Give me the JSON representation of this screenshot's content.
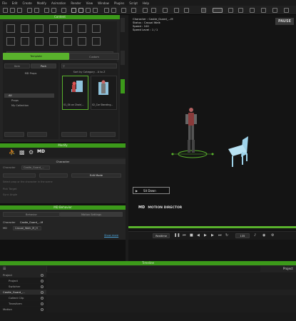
{
  "menubar": [
    "File",
    "Edit",
    "Create",
    "Modify",
    "Animation",
    "Render",
    "View",
    "Window",
    "Plugins",
    "Script",
    "Help"
  ],
  "content_panel": {
    "title": "Content",
    "tabs": [
      "Template",
      "Custom"
    ],
    "side_tabs": [
      "Scene",
      "Visual",
      "Content"
    ],
    "library_tabs": [
      "Item",
      "Pack"
    ],
    "group_label": "MD Props",
    "tree": [
      {
        "label": "All",
        "selected": true
      },
      {
        "label": "Props",
        "selected": false
      },
      {
        "label": "My Collection",
        "selected": false
      }
    ],
    "sort_label": "Sort by Category - A to Z",
    "items": [
      {
        "label": "01_Sit on Chair(...",
        "selected": true
      },
      {
        "label": "02_Car Standing...",
        "selected": false
      }
    ]
  },
  "modify_panel": {
    "title": "Modify",
    "section": "Character",
    "type_label": "Character",
    "character_name": "Castle_Guard_...",
    "mode_label": "Edit Mode",
    "hint": "Select prop or the character in the scene",
    "check1": "Pick Target",
    "check2": "Sync Angle"
  },
  "md_behavior": {
    "title": "MD Behavior",
    "tabs": [
      "Behavior",
      "Motion Settings"
    ],
    "character_label": "Character",
    "character_value": "Castle_Guard_...M",
    "md_label": "MD",
    "md_value": "Casual_Walk_M_H",
    "show_more": "Show more"
  },
  "viewport": {
    "info": [
      "Character : Castle_Guard_...M",
      "Status : Casual Walk",
      "Speed : 100",
      "Speed Level : 1 / 1"
    ],
    "pause_label": "PAUSE",
    "prompt_button": "Sit Down",
    "brand": "MOTION DIRECTOR",
    "playback_label": "Realtime",
    "frame_value": "135"
  },
  "timeline": {
    "title": "Timeline",
    "project_label": "Project",
    "rows": [
      {
        "name": "Project",
        "indent": 0
      },
      {
        "name": "Project",
        "indent": 1
      },
      {
        "name": "Switcher",
        "indent": 1
      },
      {
        "name": "Castle_Guard_...",
        "indent": 0
      },
      {
        "name": "Collect Clip",
        "indent": 1
      },
      {
        "name": "Transform",
        "indent": 1
      },
      {
        "name": "Motion",
        "indent": 0
      }
    ]
  },
  "colors": {
    "accent": "#59b22c",
    "panel": "#242424",
    "viewport": "#141414",
    "chair": "#9ed3ea"
  },
  "icons": [
    "search-icon",
    "close-icon",
    "gear-icon",
    "play-icon",
    "pause-icon",
    "motion-director-icon"
  ]
}
